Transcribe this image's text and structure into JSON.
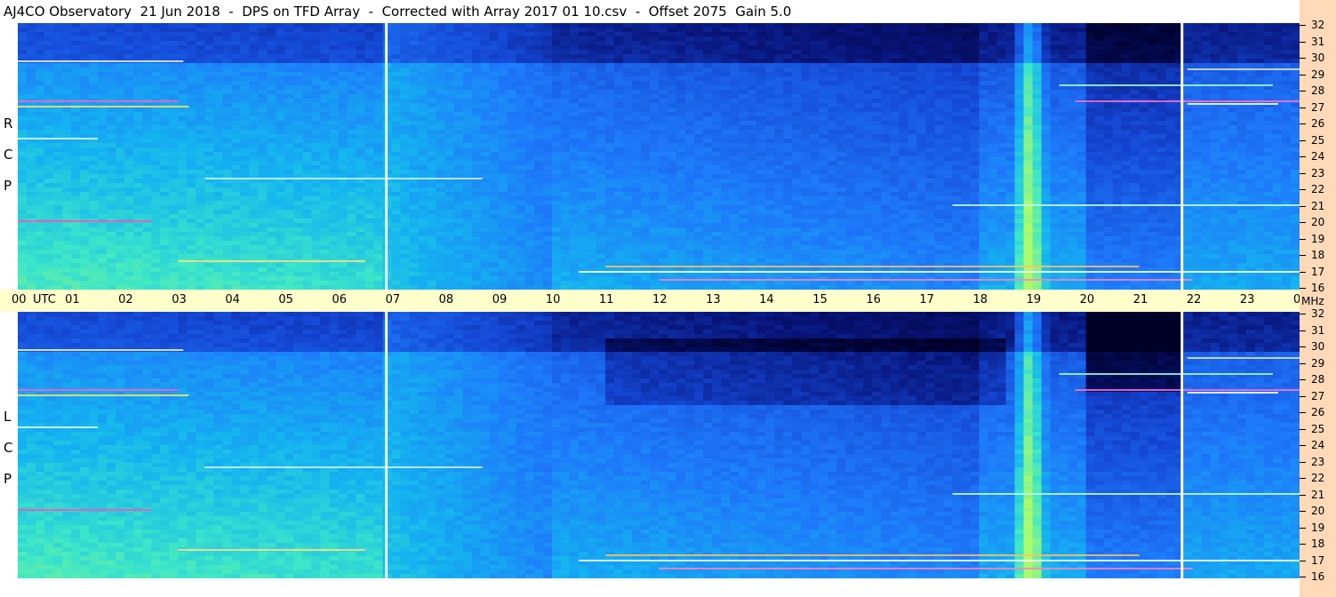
{
  "title": "AJ4CO Observatory  21 Jun 2018  -  DPS on TFD Array  -  Corrected with Array 2017 01 10.csv  -  Offset 2075  Gain 5.0",
  "panels": [
    {
      "id": "rcp",
      "letters": [
        "R",
        "C",
        "P"
      ]
    },
    {
      "id": "lcp",
      "letters": [
        "L",
        "C",
        "P"
      ]
    }
  ],
  "time_axis": {
    "labels": [
      "00",
      "UTC",
      "01",
      "02",
      "03",
      "04",
      "05",
      "06",
      "07",
      "08",
      "09",
      "10",
      "11",
      "12",
      "13",
      "14",
      "15",
      "16",
      "17",
      "18",
      "19",
      "20",
      "21",
      "22",
      "23",
      "00"
    ]
  },
  "freq_axis": {
    "unit": "MHz",
    "labels": [
      "32",
      "31",
      "30",
      "29",
      "28",
      "27",
      "26",
      "25",
      "24",
      "23",
      "22",
      "21",
      "20",
      "19",
      "18",
      "17",
      "16"
    ]
  },
  "colors": {
    "background": "#ffffff",
    "time_band": "#ffffcc",
    "freq_band": "#ffd9b8",
    "colormap_low": "#000033",
    "colormap_mid": "#1f6fff",
    "colormap_high": "#6cf7a0"
  },
  "chart_data": {
    "type": "heatmap",
    "title": "AJ4CO Observatory  21 Jun 2018  -  DPS on TFD Array  -  Corrected with Array 2017 01 10.csv  -  Offset 2075  Gain 5.0",
    "xlabel": "UTC",
    "ylabel": "MHz",
    "x_range": [
      0,
      24
    ],
    "y_range": [
      16,
      32
    ],
    "xticks": [
      "00",
      "01",
      "02",
      "03",
      "04",
      "05",
      "06",
      "07",
      "08",
      "09",
      "10",
      "11",
      "12",
      "13",
      "14",
      "15",
      "16",
      "17",
      "18",
      "19",
      "20",
      "21",
      "22",
      "23",
      "00"
    ],
    "yticks": [
      32,
      31,
      30,
      29,
      28,
      27,
      26,
      25,
      24,
      23,
      22,
      21,
      20,
      19,
      18,
      17,
      16
    ],
    "series": [
      {
        "name": "RCP"
      },
      {
        "name": "LCP"
      }
    ],
    "markers_utc": [
      6.9,
      21.8
    ],
    "grid": false
  }
}
